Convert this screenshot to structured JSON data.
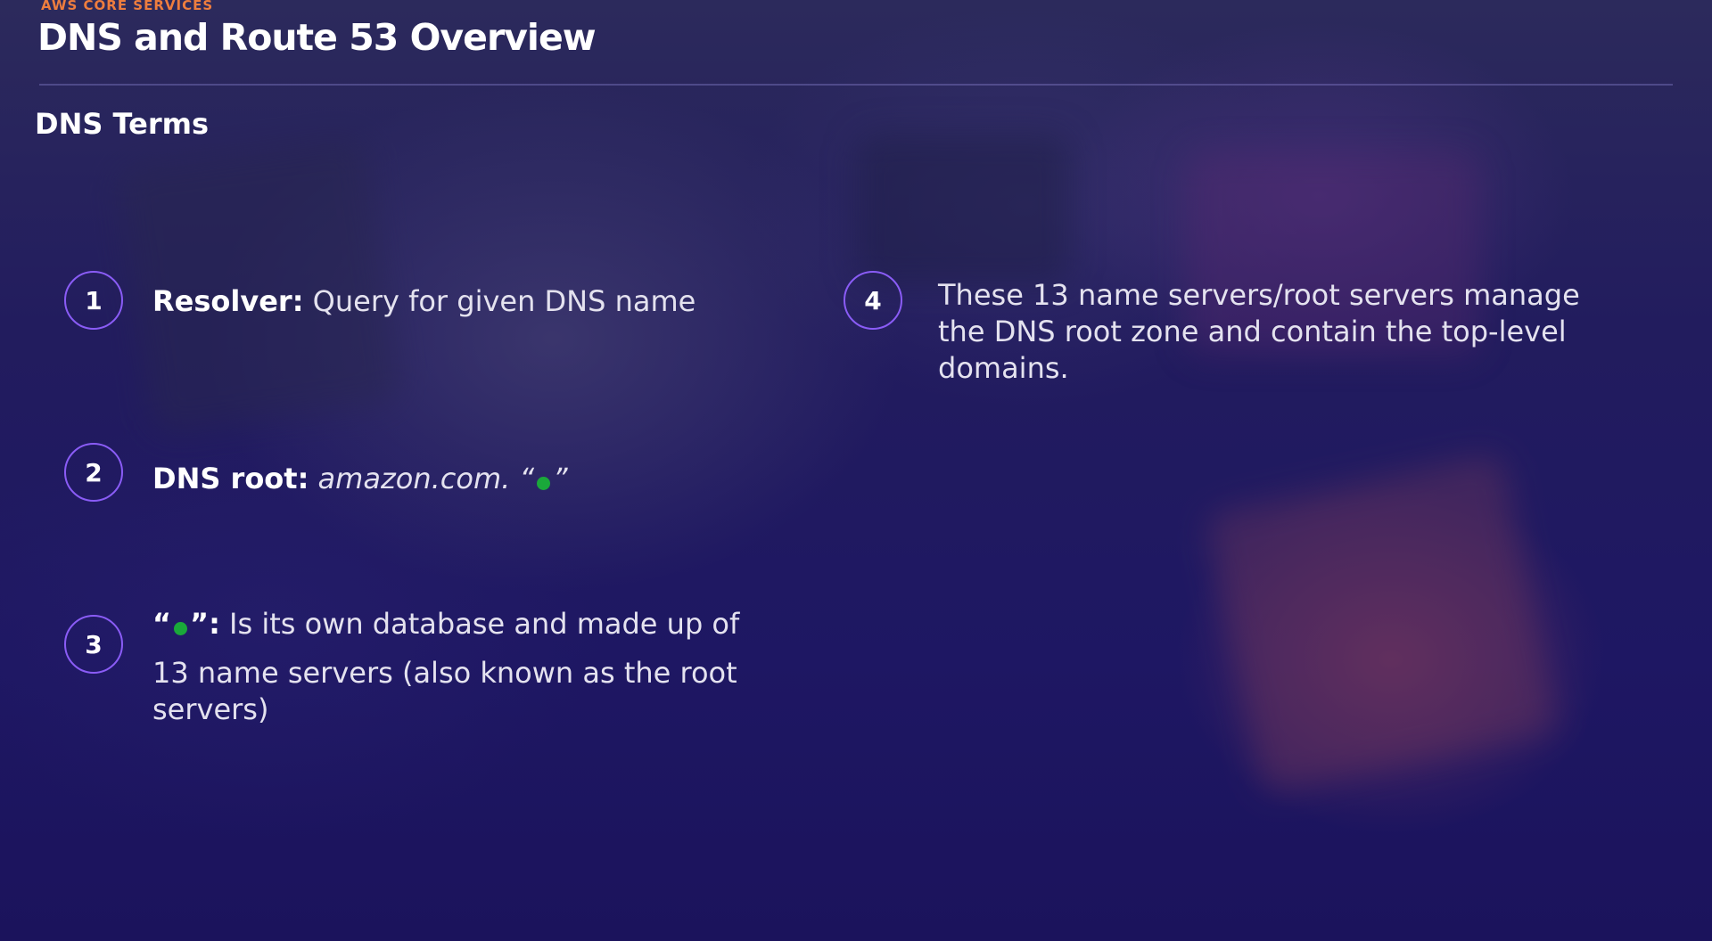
{
  "header": {
    "eyebrow": "AWS CORE SERVICES",
    "title": "DNS and Route 53 Overview"
  },
  "section": {
    "title": "DNS Terms"
  },
  "items": [
    {
      "number": "1",
      "label": "Resolver:",
      "text": "Query for given DNS name"
    },
    {
      "number": "2",
      "label": "DNS root:",
      "text": "amazon.com.",
      "quote_open": "“",
      "quote_close": "”"
    },
    {
      "number": "3",
      "quote_open": "“",
      "label_suffix": "”:",
      "text_line1": "Is its own database and made up of",
      "text_rest": "13 name servers (also known as the root servers)"
    },
    {
      "number": "4",
      "text": "These 13 name servers/root servers manage the DNS root zone and contain the top-level domains."
    }
  ],
  "colors": {
    "accent_orange": "#ee7d3e",
    "circle_border": "#8a5cf6",
    "dot_green": "#1aa83a",
    "background": "#1e1763"
  },
  "icons": {
    "root_dot": "green-dot-icon"
  }
}
